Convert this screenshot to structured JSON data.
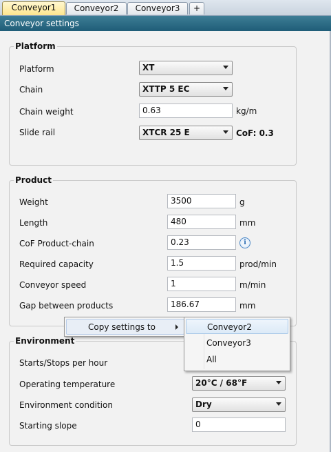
{
  "tabs": [
    {
      "label": "Conveyor1",
      "active": true
    },
    {
      "label": "Conveyor2",
      "active": false
    },
    {
      "label": "Conveyor3",
      "active": false
    },
    {
      "label": "+",
      "active": false
    }
  ],
  "window_title": "Conveyor settings",
  "platform": {
    "title": "Platform",
    "platform_label": "Platform",
    "platform_value": "XT",
    "chain_label": "Chain",
    "chain_value": "XTTP 5 EC",
    "chain_weight_label": "Chain weight",
    "chain_weight_value": "0.63",
    "chain_weight_unit": "kg/m",
    "slide_rail_label": "Slide rail",
    "slide_rail_value": "XTCR 25 E",
    "cof_text": "CoF: 0.3"
  },
  "product": {
    "title": "Product",
    "rows": [
      {
        "label": "Weight",
        "value": "3500",
        "unit": "g"
      },
      {
        "label": "Length",
        "value": "480",
        "unit": "mm"
      },
      {
        "label": "CoF Product-chain",
        "value": "0.23",
        "unit": ""
      },
      {
        "label": "Required capacity",
        "value": "1.5",
        "unit": "prod/min"
      },
      {
        "label": "Conveyor speed",
        "value": "1",
        "unit": "m/min"
      },
      {
        "label": "Gap between products",
        "value": "186.67",
        "unit": "mm"
      }
    ],
    "info_icon": "info-icon"
  },
  "environment": {
    "title": "Environment",
    "starts_label": "Starts/Stops per hour",
    "temp_label": "Operating temperature",
    "temp_value": "20°C / 68°F",
    "condition_label": "Environment condition",
    "condition_value": "Dry",
    "slope_label": "Starting slope",
    "slope_value": "0"
  },
  "context_menu": {
    "item_label": "Copy settings to",
    "submenu": [
      "Conveyor2",
      "Conveyor3",
      "All"
    ]
  }
}
